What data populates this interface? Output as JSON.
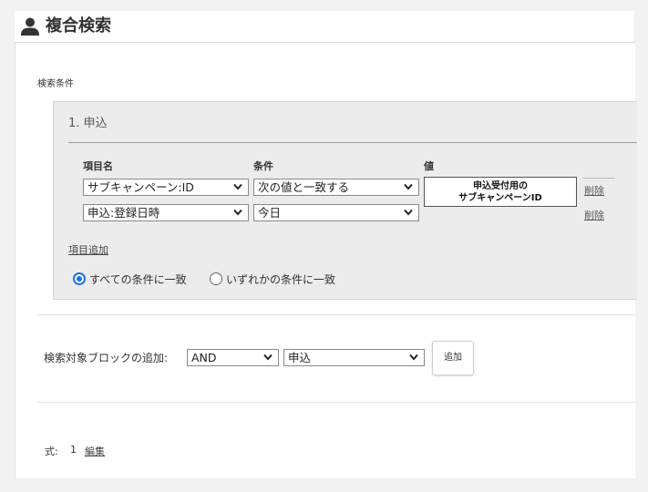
{
  "header": {
    "title": "複合検索",
    "icon": "user-icon"
  },
  "section_label": "検索条件",
  "block": {
    "title": "1. 申込",
    "columns": {
      "field": "項目名",
      "condition": "条件",
      "value": "値"
    },
    "rows": [
      {
        "field": "サブキャンペーン:ID",
        "condition": "次の値と一致する",
        "value_line1": "申込受付用の",
        "value_line2": "サブキャンペーンID",
        "delete": "削除"
      },
      {
        "field": "申込:登録日時",
        "condition": "今日",
        "delete": "削除"
      }
    ],
    "add_item": "項目追加",
    "match_all": "すべての条件に一致",
    "match_any": "いずれかの条件に一致"
  },
  "add_block": {
    "label": "検索対象ブロックの追加:",
    "operator": "AND",
    "target": "申込",
    "button": "追加"
  },
  "formula": {
    "label": "式:",
    "value": "1",
    "edit": "編集"
  },
  "colors": {
    "accent": "#1a73e8"
  }
}
